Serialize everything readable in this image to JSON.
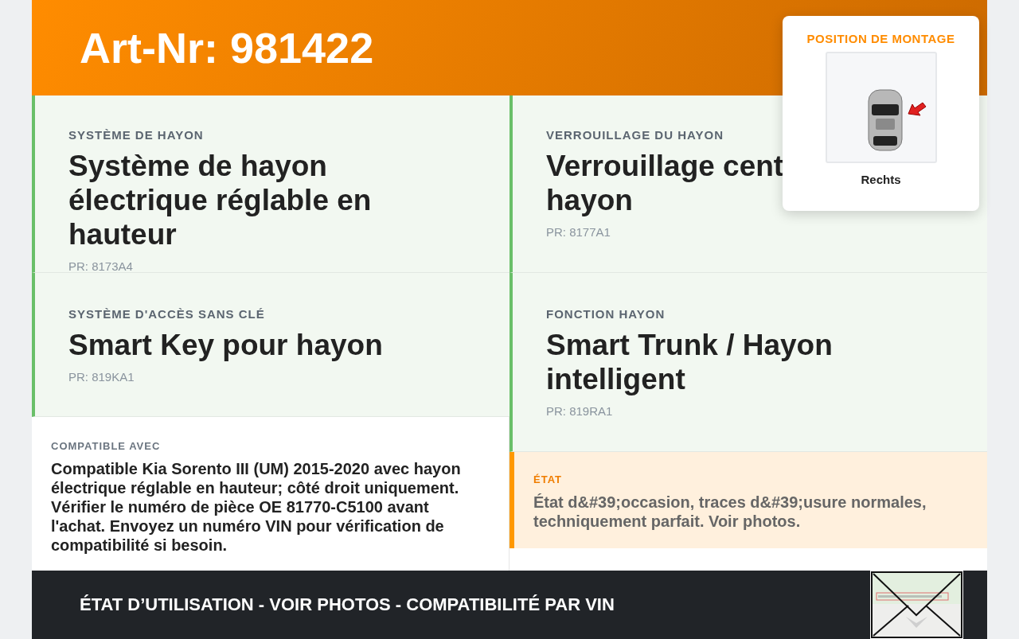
{
  "header": {
    "title": "Art-Nr: 981422"
  },
  "mounting_position": {
    "label": "POSITION DE MONTAGE",
    "side": "Rechts"
  },
  "features": [
    {
      "label": "SYSTÈME DE HAYON",
      "title": "Système de hayon électrique réglable en hauteur",
      "pr": "PR: 8173A4"
    },
    {
      "label": "VERROUILLAGE DU HAYON",
      "title": "Verrouillage cent\nhayon",
      "pr": "PR: 8177A1"
    },
    {
      "label": "SYSTÈME D'ACCÈS SANS CLÉ",
      "title": "Smart Key pour hayon",
      "pr": "PR: 819KA1"
    },
    {
      "label": "FONCTION HAYON",
      "title": "Smart Trunk / Hayon intelligent",
      "pr": "PR: 819RA1"
    }
  ],
  "compatibility": {
    "label": "COMPATIBLE AVEC",
    "text": "Compatible Kia Sorento III (UM) 2015-2020 avec hayon électrique réglable en hauteur; côté droit uniquement. Vérifier le numéro de pièce OE 81770-C5100 avant l'achat. Envoyez un numéro VIN pour vérification de compatibilité si besoin."
  },
  "condition": {
    "label": "ÉTAT",
    "text": "État d&#39;occasion, traces d&#39;usure normales, techniquement parfait. Voir photos."
  },
  "footer": {
    "text": "ÉTAT D’UTILISATION - VOIR PHOTOS - COMPATIBILITÉ PAR VIN"
  }
}
